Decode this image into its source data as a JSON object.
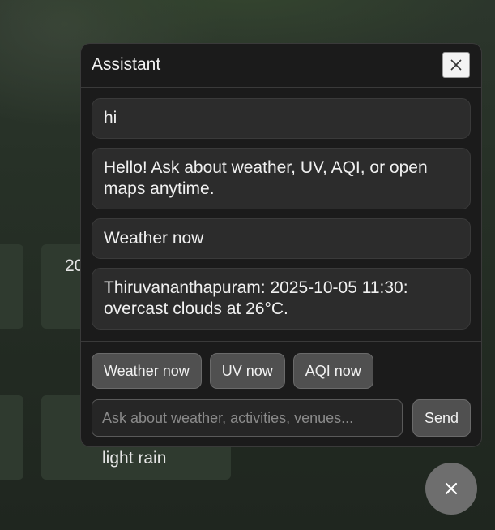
{
  "background": {
    "card_1_text": "20",
    "card_2_text": "light rain"
  },
  "assistant": {
    "title": "Assistant",
    "close_icon": "close-icon",
    "messages": [
      {
        "role": "user",
        "text": "hi"
      },
      {
        "role": "assistant",
        "text": "Hello! Ask about weather, UV, AQI, or open maps anytime."
      },
      {
        "role": "user",
        "text": "Weather now"
      },
      {
        "role": "assistant",
        "text": "Thiruvananthapuram: 2025-10-05 11:30: overcast clouds at 26°C."
      }
    ],
    "quick_actions": [
      "Weather now",
      "UV now",
      "AQI now"
    ],
    "input": {
      "value": "",
      "placeholder": "Ask about weather, activities, venues..."
    },
    "send_label": "Send"
  },
  "fab": {
    "icon": "close-icon"
  },
  "colors": {
    "panel_bg": "#1b1b1b",
    "bubble_bg": "#2c2c2c",
    "button_bg": "#505050",
    "fab_bg": "#6e6e6e"
  }
}
